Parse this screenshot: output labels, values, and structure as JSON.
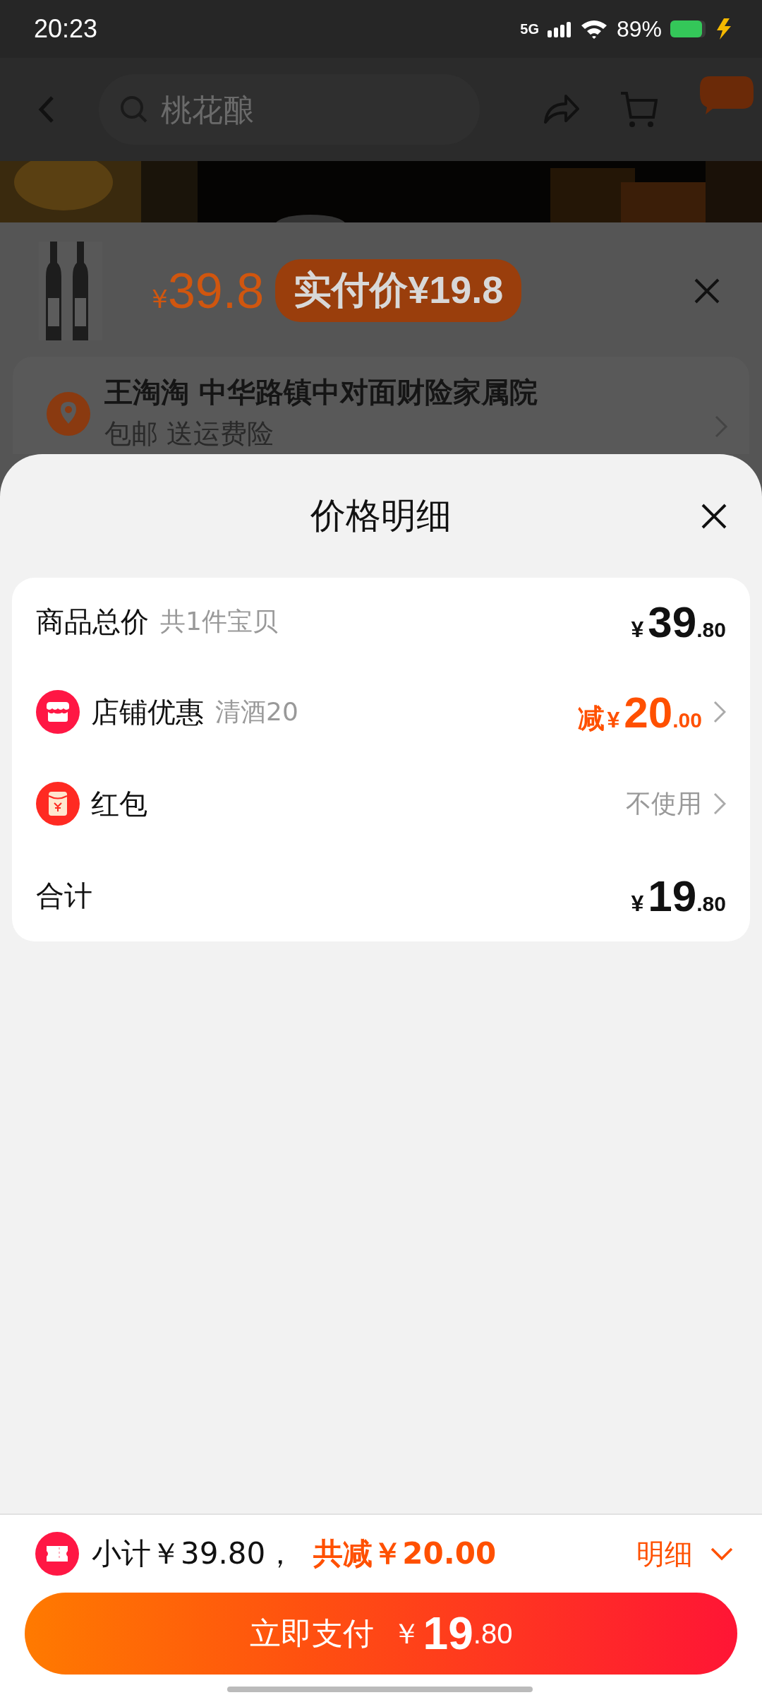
{
  "status_bar": {
    "time": "20:23",
    "network": "5G",
    "battery": "89%"
  },
  "nav_bar": {
    "search": {
      "placeholder": "桃花酿"
    }
  },
  "product": {
    "currency": "¥",
    "price": "39.8",
    "badge": "实付价¥19.8"
  },
  "address": {
    "recipient": "王淘淘 中华路镇中对面财险家属院",
    "note": "包邮 送运费险"
  },
  "sheet": {
    "title": "价格明细",
    "rows": [
      {
        "kind": "subtotal",
        "label": "商品总价",
        "note": "共1件宝贝",
        "amount": {
          "currency": "¥",
          "integer": "39",
          "decimal": ".80"
        }
      },
      {
        "kind": "shop_discount",
        "label": "店铺优惠",
        "note": "清酒20",
        "amount": {
          "prefix": "减",
          "currency": "¥",
          "integer": "20",
          "decimal": ".00"
        }
      },
      {
        "kind": "red_packet",
        "label": "红包",
        "value": "不使用"
      },
      {
        "kind": "total",
        "label": "合计",
        "amount": {
          "currency": "¥",
          "integer": "19",
          "decimal": ".80"
        }
      }
    ]
  },
  "footer": {
    "subtotal": "小计￥39.80，",
    "discount": "共减￥20.00",
    "detail_link": "明细",
    "pay_button": {
      "label": "立即支付",
      "currency": "￥",
      "integer": "19",
      "decimal": ".80"
    }
  }
}
